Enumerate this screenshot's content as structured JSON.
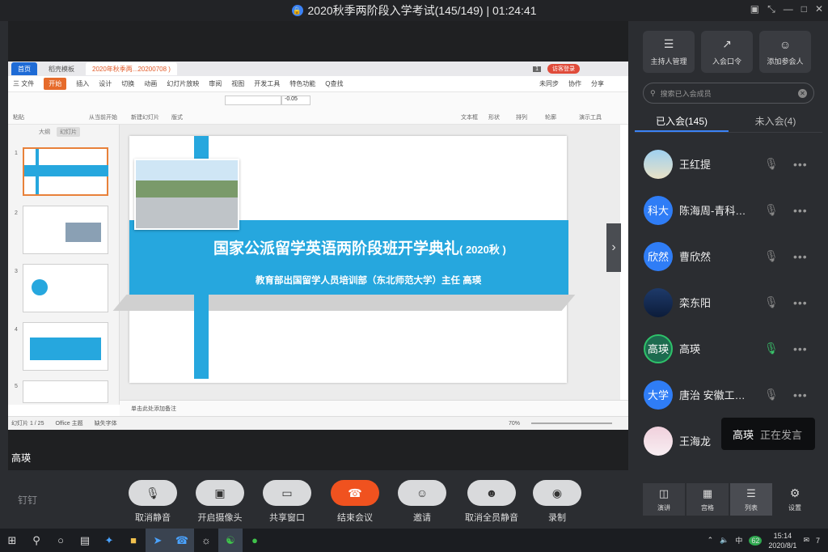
{
  "window": {
    "title": "2020秋季两阶段入学考试(145/149)  |  01:24:41"
  },
  "wps": {
    "tabs": [
      "首页",
      "稻壳模板",
      "2020年秋季两...20200708 )"
    ],
    "tab_badge": "1",
    "login_btn": "访客登录",
    "menu": [
      "三 文件",
      "开始",
      "插入",
      "设计",
      "切换",
      "动画",
      "幻灯片放映",
      "审阅",
      "视图",
      "开发工具",
      "特色功能",
      "Q查找"
    ],
    "menu_right": [
      "未同步",
      "协作",
      "分享"
    ],
    "toolbar": [
      "粘贴",
      "从当前开始",
      "新建幻灯片",
      "版式",
      "文本框",
      "形状",
      "排列",
      "轮廓",
      "演示工具"
    ],
    "font_size": "-0.05",
    "left_tabs": [
      "大纲",
      "幻灯片"
    ],
    "slide_numbers": [
      "1",
      "2",
      "3",
      "4",
      "5"
    ],
    "notes": "单击此处添加备注",
    "status": {
      "slide": "幻灯片 1 / 25",
      "theme": "Office 主题",
      "font": "缺失字体",
      "zoom": "70%"
    }
  },
  "slide": {
    "title": "国家公派留学英语两阶段班开学典礼",
    "title_suffix": "( 2020秋 )",
    "subtitle": "教育部出国留学人员培训部（东北师范大学）主任  高瑛"
  },
  "speaker_label": "高瑛",
  "panel": {
    "buttons": [
      {
        "icon": "sliders-icon",
        "label": "主持人管理"
      },
      {
        "icon": "share-icon",
        "label": "入会口令"
      },
      {
        "icon": "add-user-icon",
        "label": "添加参会人"
      }
    ],
    "search_placeholder": "搜索已入会成员",
    "tabs": [
      "已入会(145)",
      "未入会(4)"
    ],
    "participants": [
      {
        "name": "王红提",
        "avatar": ""
      },
      {
        "name": "陈海周-青科…",
        "avatar": "科大"
      },
      {
        "name": "曹欣然",
        "avatar": "欣然"
      },
      {
        "name": "栾东阳",
        "avatar": ""
      },
      {
        "name": "高瑛",
        "avatar": "高瑛"
      },
      {
        "name": "唐治 安徽工…",
        "avatar": "大学"
      },
      {
        "name": "王海龙",
        "avatar": ""
      }
    ],
    "tooltip_name": "高瑛",
    "tooltip_status": "正在发言"
  },
  "controls": {
    "brand": "钉钉",
    "buttons": [
      "取消静音",
      "开启摄像头",
      "共享窗口",
      "结束会议",
      "邀请",
      "取消全员静音",
      "录制"
    ],
    "layout": [
      "演讲",
      "宫格",
      "列表"
    ],
    "settings": "设置"
  },
  "taskbar": {
    "time": "15:14",
    "date": "2020/8/1",
    "lang": "中",
    "badge": "62",
    "notif": "7"
  }
}
